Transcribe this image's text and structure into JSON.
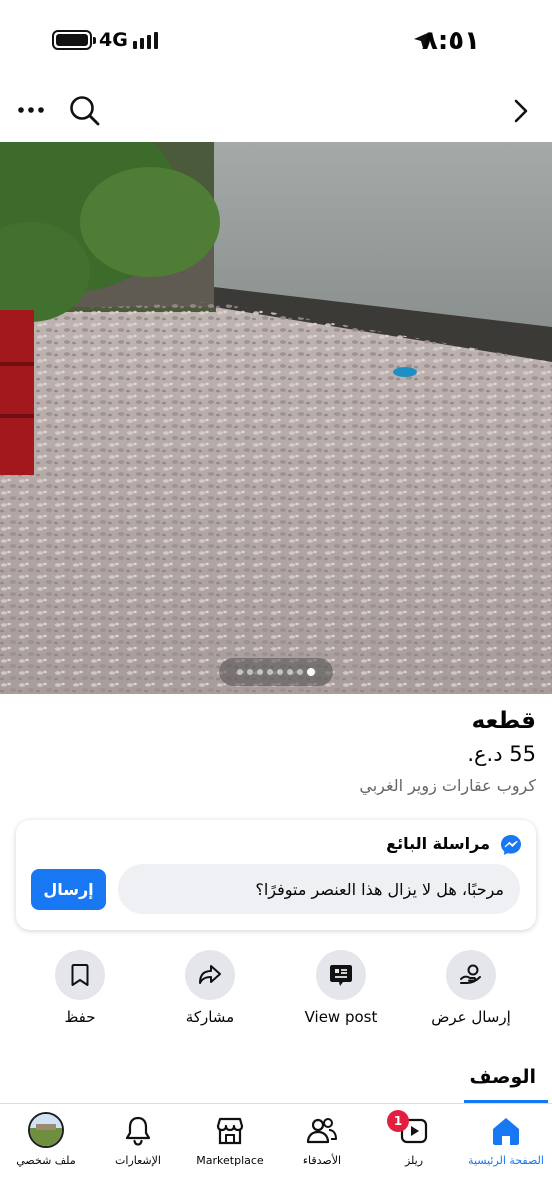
{
  "status_bar": {
    "network": "4G",
    "time": "٨:٥١"
  },
  "nav": {
    "more_icon": "more-dots-icon",
    "search_icon": "search-icon",
    "forward_icon": "chevron-right-icon"
  },
  "photo": {
    "total_images": 8,
    "current_index": 8
  },
  "listing": {
    "title": "قطعه",
    "price": "55 د.ع.",
    "seller": "كروب عقارات زوير الغربي"
  },
  "message_card": {
    "title": "مراسلة البائع",
    "input_value": "مرحبًا، هل لا يزال هذا العنصر متوفرًا؟",
    "send_label": "إرسال"
  },
  "actions": [
    {
      "label": "إرسال عرض",
      "icon": "offer-hand-icon"
    },
    {
      "label": "View post",
      "icon": "post-icon"
    },
    {
      "label": "مشاركة",
      "icon": "share-arrow-icon"
    },
    {
      "label": "حفظ",
      "icon": "bookmark-icon"
    }
  ],
  "description_tab": "الوصف",
  "tab_bar": {
    "items": [
      {
        "label": "الصفحة الرئيسية",
        "icon": "home-icon",
        "active": true
      },
      {
        "label": "ريلز",
        "icon": "reels-icon",
        "badge": "1"
      },
      {
        "label": "الأصدقاء",
        "icon": "friends-icon"
      },
      {
        "label": "Marketplace",
        "icon": "marketplace-icon"
      },
      {
        "label": "الإشعارات",
        "icon": "bell-icon"
      },
      {
        "label": "ملف شخصي",
        "icon": "avatar"
      }
    ]
  },
  "colors": {
    "accent": "#1877f2",
    "badge": "#e41e3f",
    "secondary_text": "#65676b"
  }
}
